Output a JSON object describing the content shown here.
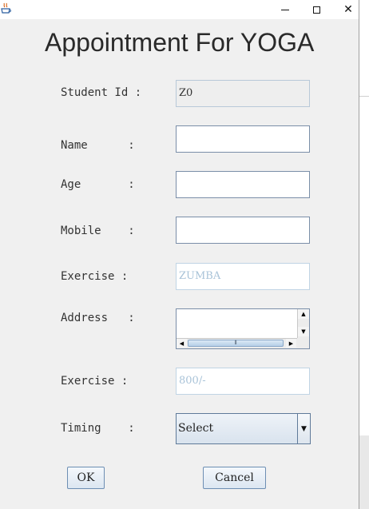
{
  "window": {
    "icon": "java-cup-icon",
    "controls": {
      "minimize": "—",
      "maximize": "☐",
      "close": "✕"
    }
  },
  "form": {
    "title": "Appointment For YOGA",
    "fields": {
      "student_id": {
        "label": "Student Id :",
        "value": "Z0"
      },
      "name": {
        "label": "Name      :",
        "value": ""
      },
      "age": {
        "label": "Age       :",
        "value": ""
      },
      "mobile": {
        "label": "Mobile    :",
        "value": ""
      },
      "exercise": {
        "label": "Exercise :",
        "value": "ZUMBA"
      },
      "address": {
        "label": "Address   :",
        "value": ""
      },
      "fee": {
        "label": "Exercise :",
        "value": "800/-"
      },
      "timing": {
        "label": "Timing    :",
        "selected": "Select"
      }
    },
    "scroll": {
      "up": "▲",
      "down": "▼",
      "left": "◀",
      "right": "▶",
      "grip": "⦀"
    },
    "combo_arrow": "▼",
    "buttons": {
      "ok": "OK",
      "cancel": "Cancel"
    }
  },
  "colors": {
    "window_bg": "#f0f0f0",
    "field_border": "#7a8ea8",
    "disabled_text": "#a9c3d8",
    "button_border": "#6d8eb3"
  }
}
